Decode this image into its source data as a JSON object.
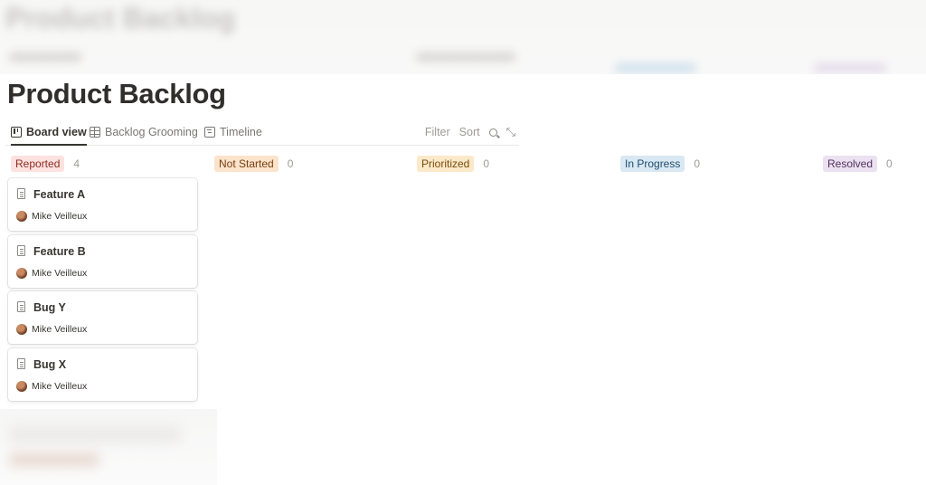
{
  "page": {
    "title": "Product Backlog"
  },
  "views": [
    {
      "label": "Board view",
      "icon": "board-icon"
    },
    {
      "label": "Backlog Grooming",
      "icon": "table-icon"
    },
    {
      "label": "Timeline",
      "icon": "timeline-icon"
    }
  ],
  "toolbar": {
    "filter_label": "Filter",
    "sort_label": "Sort",
    "search_icon": "search-icon",
    "expand_icon": "expand-icon"
  },
  "columns": [
    {
      "label": "Reported",
      "count": "4",
      "color": "#fde2e0"
    },
    {
      "label": "Not Started",
      "count": "0",
      "color": "#fbe3cc"
    },
    {
      "label": "Prioritized",
      "count": "0",
      "color": "#fbe9c9"
    },
    {
      "label": "In Progress",
      "count": "0",
      "color": "#d9e8f3"
    },
    {
      "label": "Resolved",
      "count": "0",
      "color": "#ebe1f1"
    }
  ],
  "cards": [
    {
      "title": "Feature A",
      "person": "Mike Veilleux"
    },
    {
      "title": "Feature B",
      "person": "Mike Veilleux"
    },
    {
      "title": "Bug Y",
      "person": "Mike Veilleux"
    },
    {
      "title": "Bug X",
      "person": "Mike Veilleux"
    }
  ]
}
